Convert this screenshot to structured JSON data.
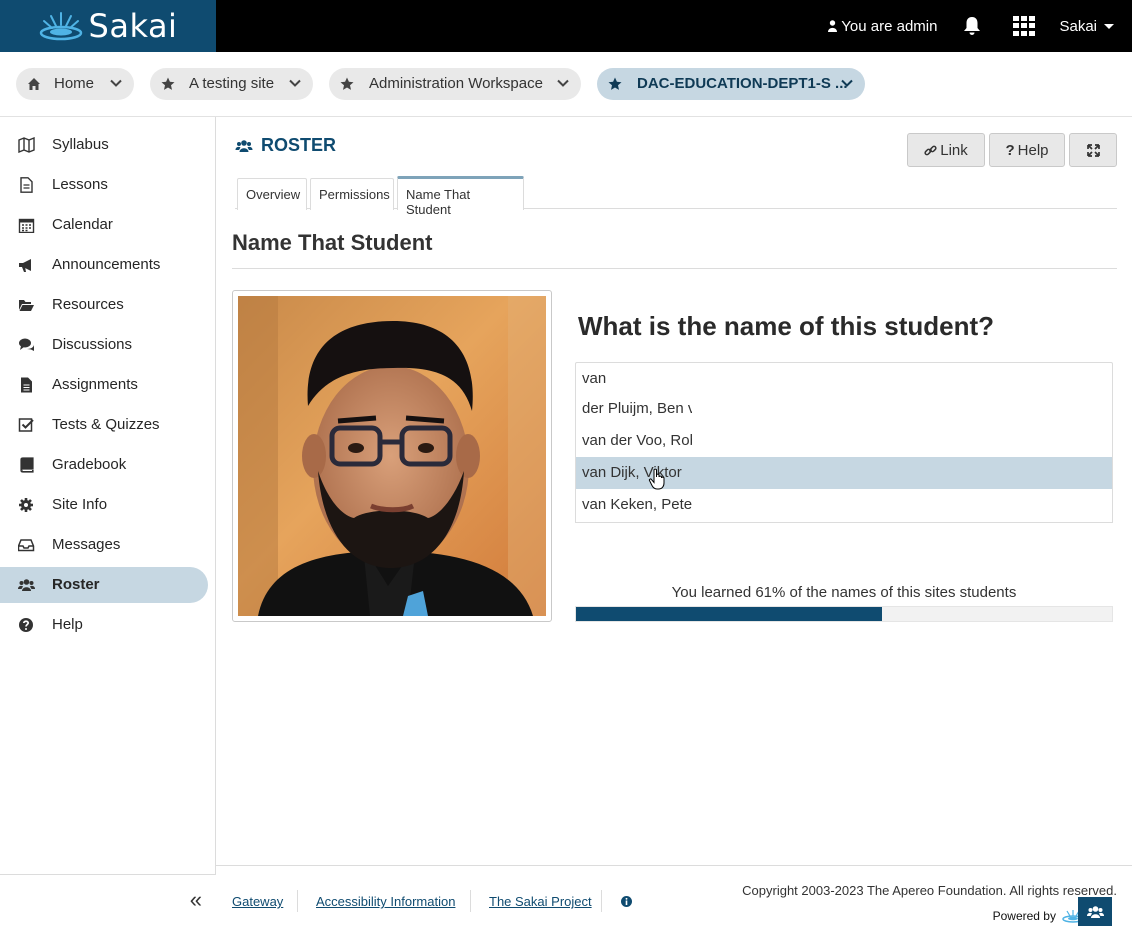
{
  "header": {
    "logo_text": "Sakai",
    "user_label": "You are admin",
    "site_menu_label": "Sakai"
  },
  "site_tabs": [
    {
      "label": "Home",
      "icon": "home-icon"
    },
    {
      "label": "A testing site",
      "icon": "star-icon"
    },
    {
      "label": "Administration Workspace",
      "icon": "star-icon"
    },
    {
      "label": "DAC-EDUCATION-DEPT1-S ...",
      "icon": "star-icon",
      "active": true
    }
  ],
  "sidebar": {
    "items": [
      {
        "label": "Syllabus",
        "icon": "map-icon"
      },
      {
        "label": "Lessons",
        "icon": "file-icon"
      },
      {
        "label": "Calendar",
        "icon": "calendar-icon"
      },
      {
        "label": "Announcements",
        "icon": "megaphone-icon"
      },
      {
        "label": "Resources",
        "icon": "folder-icon"
      },
      {
        "label": "Discussions",
        "icon": "comments-icon"
      },
      {
        "label": "Assignments",
        "icon": "file-text-icon"
      },
      {
        "label": "Tests & Quizzes",
        "icon": "check-square-icon"
      },
      {
        "label": "Gradebook",
        "icon": "book-icon"
      },
      {
        "label": "Site Info",
        "icon": "gear-icon"
      },
      {
        "label": "Messages",
        "icon": "inbox-icon"
      },
      {
        "label": "Roster",
        "icon": "users-icon",
        "active": true
      },
      {
        "label": "Help",
        "icon": "question-circle-icon"
      }
    ]
  },
  "tool": {
    "title": "ROSTER",
    "link_label": "Link",
    "help_label": "Help"
  },
  "tabs": [
    "Overview",
    "Permissions",
    "Name That Student"
  ],
  "main": {
    "section_title": "Name That Student",
    "question": "What is the name of this student?",
    "input_value": "van",
    "suggestions": [
      "der Pluijm, Ben v",
      "van der Voo, Rob",
      "van Dijk, Viktor",
      "van Keken, Peter"
    ],
    "progress_text": "You learned 61% of the names of this sites students",
    "progress_fraction": 0.57
  },
  "footer": {
    "links": [
      "Gateway",
      "Accessibility Information",
      "The Sakai Project"
    ],
    "copyright": "Copyright 2003-2023 The Apereo Foundation. All rights reserved.",
    "powered_by": "Powered by",
    "powered_logo_text": "S"
  },
  "colors": {
    "brand": "#0f4b70",
    "active_bg": "#c6d7e2"
  }
}
